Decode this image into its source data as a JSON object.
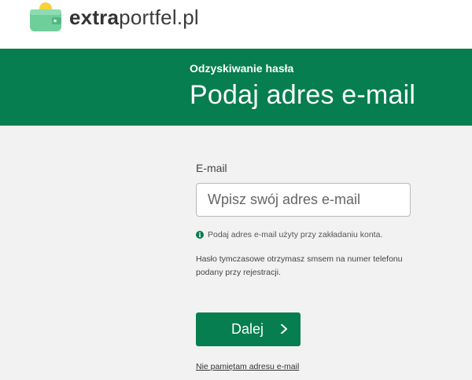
{
  "header": {
    "logo_bold": "extra",
    "logo_regular": "portfel.pl"
  },
  "hero": {
    "subtitle": "Odzyskiwanie hasła",
    "title": "Podaj adres e-mail"
  },
  "form": {
    "email_label": "E-mail",
    "email_value": "",
    "email_placeholder": "Wpisz swój adres e-mail",
    "hint": "Podaj adres e-mail użyty przy zakładaniu konta.",
    "note": "Hasło tymczasowe otrzymasz smsem na numer telefonu podany przy rejestracji.",
    "next_label": "Dalej",
    "forgot_link": "Nie pamiętam adresu e-mail"
  },
  "colors": {
    "brand_green": "#067e4f",
    "wallet_green": "#6fcf9a",
    "coin_yellow": "#f5d23c",
    "page_background": "#f2f2f2"
  },
  "icons": {
    "logo": "wallet-with-coin-icon",
    "hint": "info-icon",
    "next": "chevron-right-icon"
  }
}
